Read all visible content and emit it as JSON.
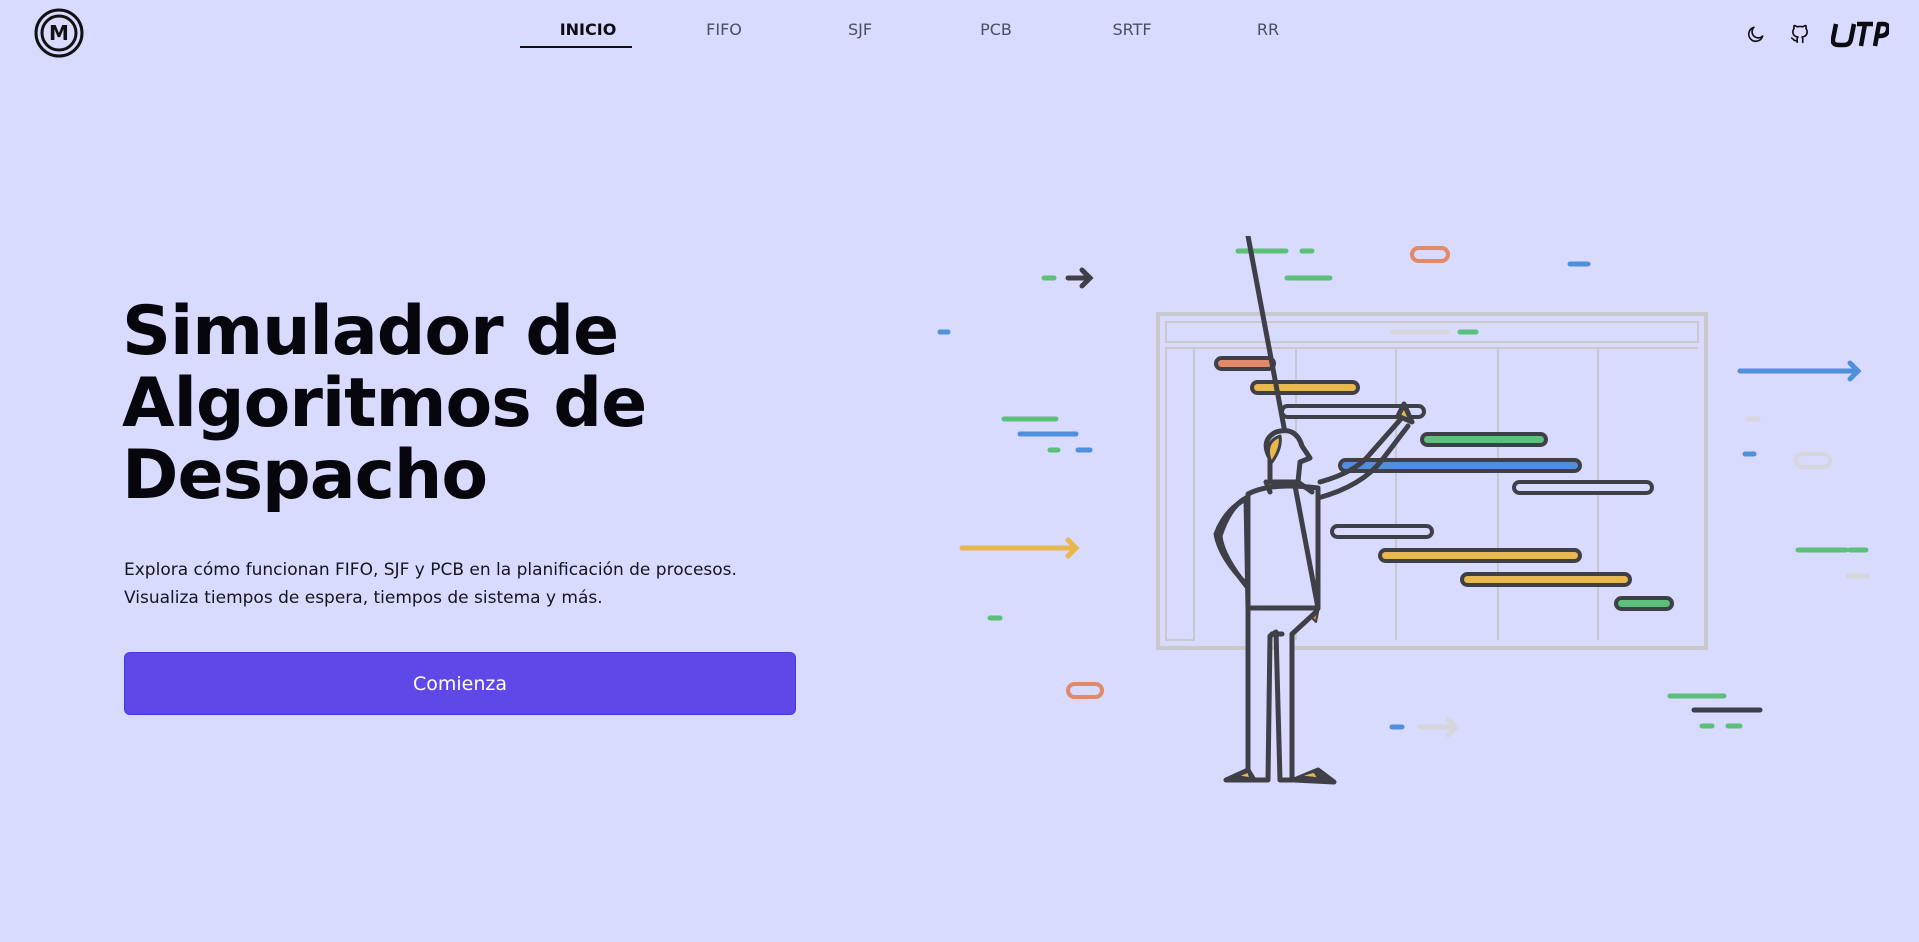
{
  "header": {
    "logo": "M",
    "nav": [
      {
        "label": "INICIO",
        "active": true
      },
      {
        "label": "FIFO",
        "active": false
      },
      {
        "label": "SJF",
        "active": false
      },
      {
        "label": "PCB",
        "active": false
      },
      {
        "label": "SRTF",
        "active": false
      },
      {
        "label": "RR",
        "active": false
      }
    ],
    "icons": [
      "moon-icon",
      "github-icon",
      "utp-logo-icon"
    ]
  },
  "hero": {
    "title_lines": [
      "Simulador de",
      "Algoritmos de",
      "Despacho"
    ],
    "description_lines": [
      "Explora cómo funcionan FIFO, SJF y PCB en la planificación de procesos.",
      "Visualiza tiempos de espera, tiempos de sistema y más."
    ],
    "cta_label": "Comienza"
  },
  "colors": {
    "background": "#d8dafe",
    "accent": "#5f48e8",
    "green": "#5cbf7a",
    "blue": "#4f8fdc",
    "yellow": "#e8b84e",
    "orange": "#e08a6a",
    "outline": "#3f3f47"
  }
}
